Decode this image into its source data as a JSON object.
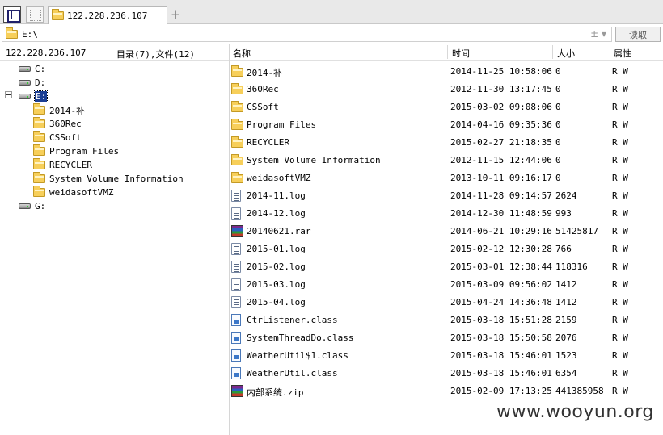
{
  "tab": {
    "label": "122.228.236.107",
    "new_tab_symbol": "+"
  },
  "address": {
    "path": "E:\\",
    "dropdown_symbol": "± ▾",
    "read_button": "读取"
  },
  "left": {
    "host": "122.228.236.107",
    "summary": "目录(7),文件(12)",
    "drives": [
      "C:",
      "D:",
      "E:",
      "G:"
    ],
    "folders": [
      "2014-补",
      "360Rec",
      "CSSoft",
      "Program Files",
      "RECYCLER",
      "System Volume Information",
      "weidasoftVMZ"
    ]
  },
  "columns": {
    "name": "名称",
    "time": "时间",
    "size": "大小",
    "attr": "属性"
  },
  "files": [
    {
      "icon": "folder-icon",
      "name": "2014-补",
      "time": "2014-11-25 10:58:06",
      "size": "0",
      "attr": "R W"
    },
    {
      "icon": "folder-icon",
      "name": "360Rec",
      "time": "2012-11-30 13:17:45",
      "size": "0",
      "attr": "R W"
    },
    {
      "icon": "folder-icon",
      "name": "CSSoft",
      "time": "2015-03-02 09:08:06",
      "size": "0",
      "attr": "R W"
    },
    {
      "icon": "folder-icon",
      "name": "Program Files",
      "time": "2014-04-16 09:35:36",
      "size": "0",
      "attr": "R W"
    },
    {
      "icon": "folder-icon",
      "name": "RECYCLER",
      "time": "2015-02-27 21:18:35",
      "size": "0",
      "attr": "R W"
    },
    {
      "icon": "folder-icon",
      "name": "System Volume Information",
      "time": "2012-11-15 12:44:06",
      "size": "0",
      "attr": "R W"
    },
    {
      "icon": "folder-icon",
      "name": "weidasoftVMZ",
      "time": "2013-10-11 09:16:17",
      "size": "0",
      "attr": "R W"
    },
    {
      "icon": "log-file-icon",
      "name": "2014-11.log",
      "time": "2014-11-28 09:14:57",
      "size": "2624",
      "attr": "R W"
    },
    {
      "icon": "log-file-icon",
      "name": "2014-12.log",
      "time": "2014-12-30 11:48:59",
      "size": "993",
      "attr": "R W"
    },
    {
      "icon": "rar-archive-icon",
      "name": "20140621.rar",
      "time": "2014-06-21 10:29:16",
      "size": "51425817",
      "attr": "R W"
    },
    {
      "icon": "log-file-icon",
      "name": "2015-01.log",
      "time": "2015-02-12 12:30:28",
      "size": "766",
      "attr": "R W"
    },
    {
      "icon": "log-file-icon",
      "name": "2015-02.log",
      "time": "2015-03-01 12:38:44",
      "size": "118316",
      "attr": "R W"
    },
    {
      "icon": "log-file-icon",
      "name": "2015-03.log",
      "time": "2015-03-09 09:56:02",
      "size": "1412",
      "attr": "R W"
    },
    {
      "icon": "log-file-icon",
      "name": "2015-04.log",
      "time": "2015-04-24 14:36:48",
      "size": "1412",
      "attr": "R W"
    },
    {
      "icon": "class-file-icon",
      "name": "CtrListener.class",
      "time": "2015-03-18 15:51:28",
      "size": "2159",
      "attr": "R W"
    },
    {
      "icon": "class-file-icon",
      "name": "SystemThreadDo.class",
      "time": "2015-03-18 15:50:58",
      "size": "2076",
      "attr": "R W"
    },
    {
      "icon": "class-file-icon",
      "name": "WeatherUtil$1.class",
      "time": "2015-03-18 15:46:01",
      "size": "1523",
      "attr": "R W"
    },
    {
      "icon": "class-file-icon",
      "name": "WeatherUtil.class",
      "time": "2015-03-18 15:46:01",
      "size": "6354",
      "attr": "R W"
    },
    {
      "icon": "zip-archive-icon",
      "name": "内部系统.zip",
      "time": "2015-02-09 17:13:25",
      "size": "441385958",
      "attr": "R W"
    }
  ],
  "watermark": "www.wooyun.org"
}
